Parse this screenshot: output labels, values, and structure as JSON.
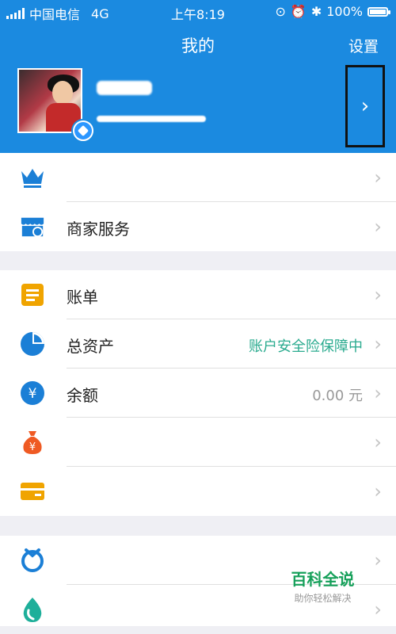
{
  "status_bar": {
    "carrier": "中国电信",
    "network": "4G",
    "time": "上午8:19",
    "battery": "100%"
  },
  "header": {
    "title": "我的",
    "settings_label": "设置",
    "arrow": "›"
  },
  "menu": {
    "chevron": "›",
    "crown": {
      "label": ""
    },
    "merchant": {
      "label": "商家服务"
    },
    "bill": {
      "label": "账单"
    },
    "assets": {
      "label": "总资产",
      "value": "账户安全险保障中"
    },
    "balance": {
      "label": "余额",
      "value": "0.00 元"
    },
    "yuebao": {
      "label": ""
    },
    "cards": {
      "label": ""
    },
    "ant_credit": {
      "label": ""
    },
    "last_item": {
      "label": ""
    }
  },
  "colors": {
    "header_blue": "#1b8ae0",
    "green_text": "#2bab8f",
    "gray_text": "#999999"
  },
  "watermark": {
    "title": "百科全说",
    "subtitle": "助你轻松解决"
  }
}
